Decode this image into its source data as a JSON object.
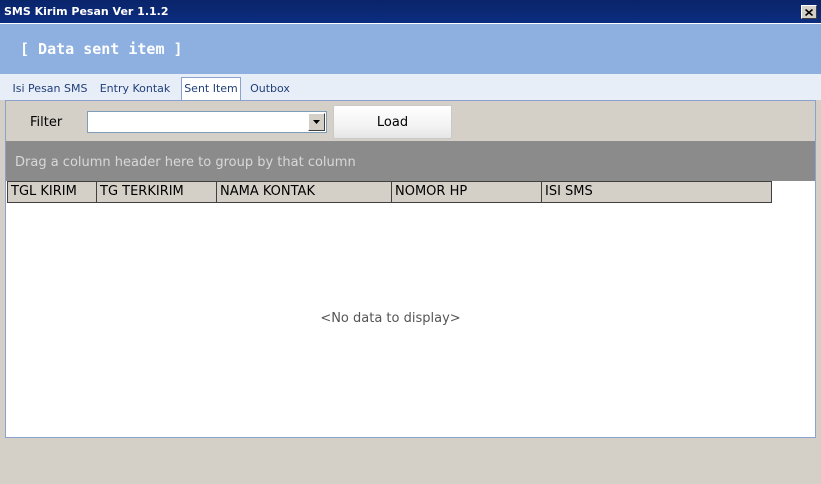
{
  "window": {
    "title": "SMS Kirim Pesan Ver 1.1.2",
    "close_icon": "close-icon"
  },
  "banner": {
    "heading": "[ Data sent item ]"
  },
  "tabs": [
    {
      "label": "Isi Pesan SMS",
      "active": false
    },
    {
      "label": "Entry Kontak",
      "active": false
    },
    {
      "label": "Sent Item",
      "active": true
    },
    {
      "label": "Outbox",
      "active": false
    }
  ],
  "filter": {
    "label": "Filter",
    "value": "",
    "load_label": "Load"
  },
  "grid": {
    "group_hint": "Drag a column header here to group by that column",
    "columns": [
      "TGL KIRIM",
      "TG TERKIRIM",
      "NAMA KONTAK",
      "NOMOR HP",
      "ISI SMS"
    ],
    "empty_text": "<No data to display>"
  },
  "colors": {
    "title_bar": "#0a246a",
    "banner": "#8db0e1",
    "group_panel": "#8b8b8b"
  }
}
